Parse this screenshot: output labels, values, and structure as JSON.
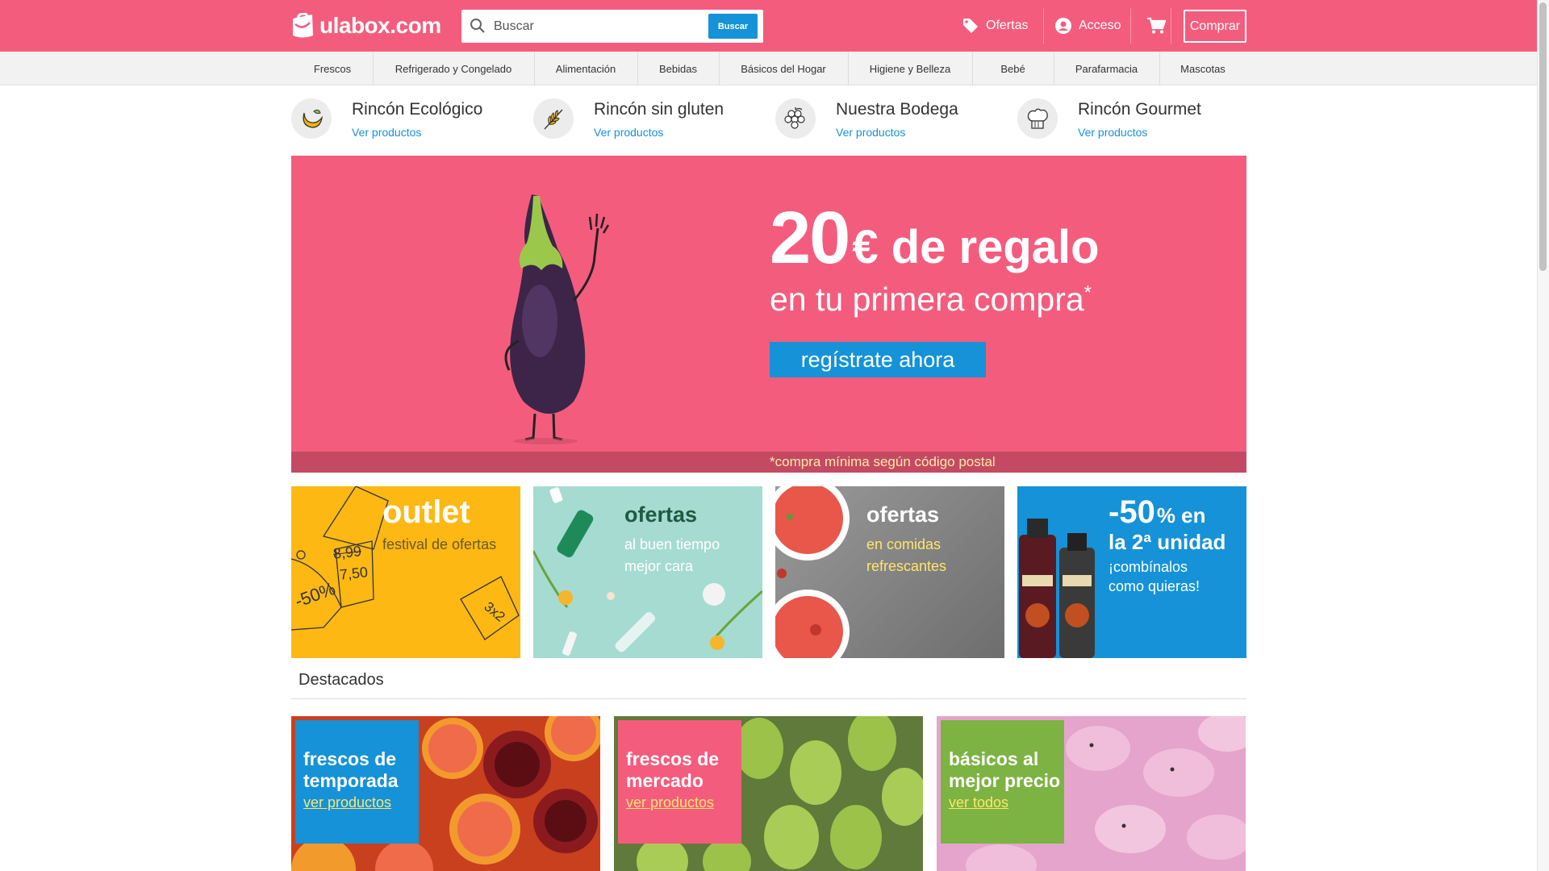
{
  "header": {
    "logo_text": "ulabox.com",
    "search_placeholder": "Buscar",
    "search_button": "Buscar",
    "ofertas": "Ofertas",
    "acceso": "Acceso",
    "comprar": "Comprar"
  },
  "categories": [
    "Frescos",
    "Refrigerado y Congelado",
    "Alimentación",
    "Bebidas",
    "Básicos del Hogar",
    "Higiene y Belleza",
    "Bebé",
    "Parafarmacia",
    "Mascotas"
  ],
  "corners": [
    {
      "title": "Rincón Ecológico",
      "link": "Ver productos",
      "icon": "leaf-moon-icon"
    },
    {
      "title": "Rincón sin gluten",
      "link": "Ver productos",
      "icon": "wheat-icon"
    },
    {
      "title": "Nuestra Bodega",
      "link": "Ver productos",
      "icon": "grapes-icon"
    },
    {
      "title": "Rincón Gourmet",
      "link": "Ver productos",
      "icon": "chef-hat-icon"
    }
  ],
  "hero": {
    "amount": "20",
    "headline_rest": "€ de regalo",
    "subline": "en tu primera compra",
    "subline_mark": "*",
    "cta": "regístrate ahora",
    "footnote": "*compra mínima según código postal"
  },
  "promos": [
    {
      "title": "outlet",
      "sub": "festival de ofertas",
      "tags": [
        "8,99",
        "7,50",
        "-50%",
        "3x2"
      ],
      "bg": "#fdb813"
    },
    {
      "title": "ofertas",
      "sub1": "al buen tiempo",
      "sub2": "mejor cara",
      "bg": "#a6dbd1"
    },
    {
      "title": "ofertas",
      "sub1": "en comidas",
      "sub2": "refrescantes",
      "bg": "#8d8d8d"
    },
    {
      "title_big": "-50",
      "title_rest": "% en",
      "title_line2": "la 2ª unidad",
      "sub1": "¡combínalos",
      "sub2": "como quieras!",
      "bg": "#1592d8"
    }
  ],
  "destacados": {
    "title": "Destacados",
    "items": [
      {
        "line1": "frescos de",
        "line2": "temporada",
        "link": "ver productos",
        "box_color": "#1592d8"
      },
      {
        "line1": "frescos de",
        "line2": "mercado",
        "link": "ver productos",
        "box_color": "#f45c7d"
      },
      {
        "line1": "básicos al",
        "line2": "mejor precio",
        "link": "ver todos",
        "box_color": "#7cb342"
      }
    ]
  },
  "colors": {
    "brand_pink": "#f45c7d",
    "brand_blue": "#1592d8",
    "link_blue": "#1592d8"
  }
}
